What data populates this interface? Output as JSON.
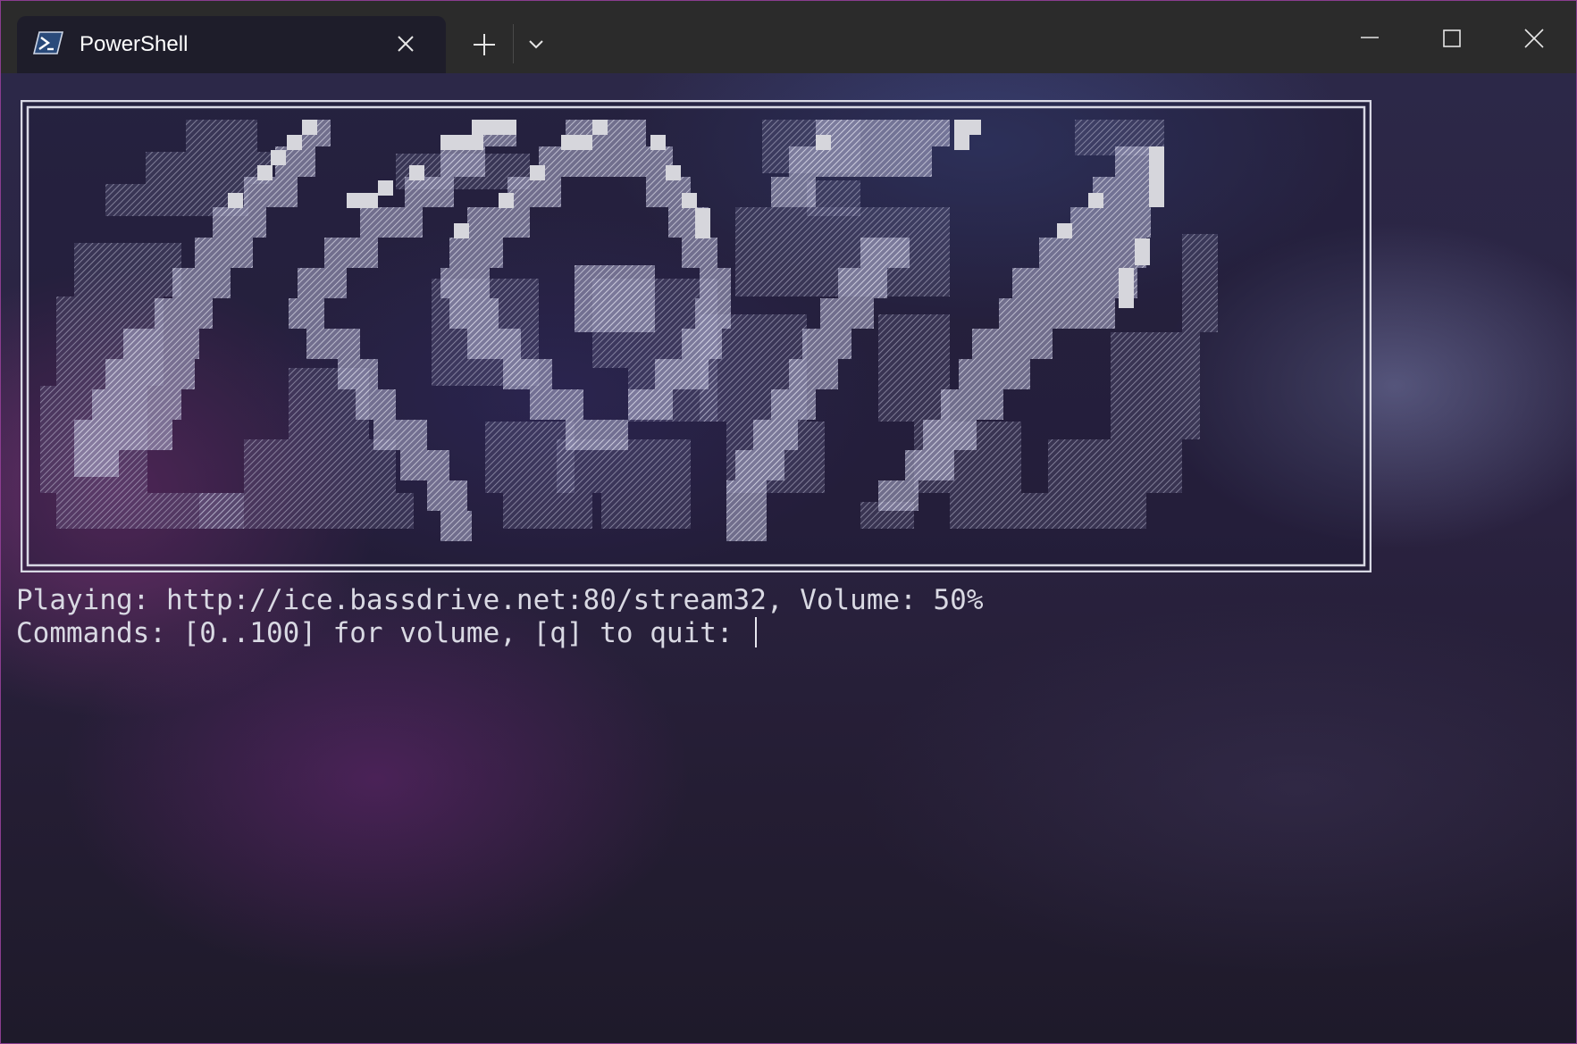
{
  "tab": {
    "title": "PowerShell",
    "icon": "powershell-icon"
  },
  "titlebar_buttons": [
    "new-tab-icon",
    "chevron-down-icon",
    "minimize-icon",
    "maximize-icon",
    "close-icon"
  ],
  "terminal": {
    "line1": "Playing: http://ice.bassdrive.net:80/stream32, Volume: 50%",
    "line2": "Commands: [0..100] for volume, [q] to quit: "
  },
  "colors": {
    "titlebar": "#2b2b2b",
    "tab_active": "#1e1d2a",
    "text": "#d9d9e3",
    "window_border": "#8a3d8f"
  }
}
